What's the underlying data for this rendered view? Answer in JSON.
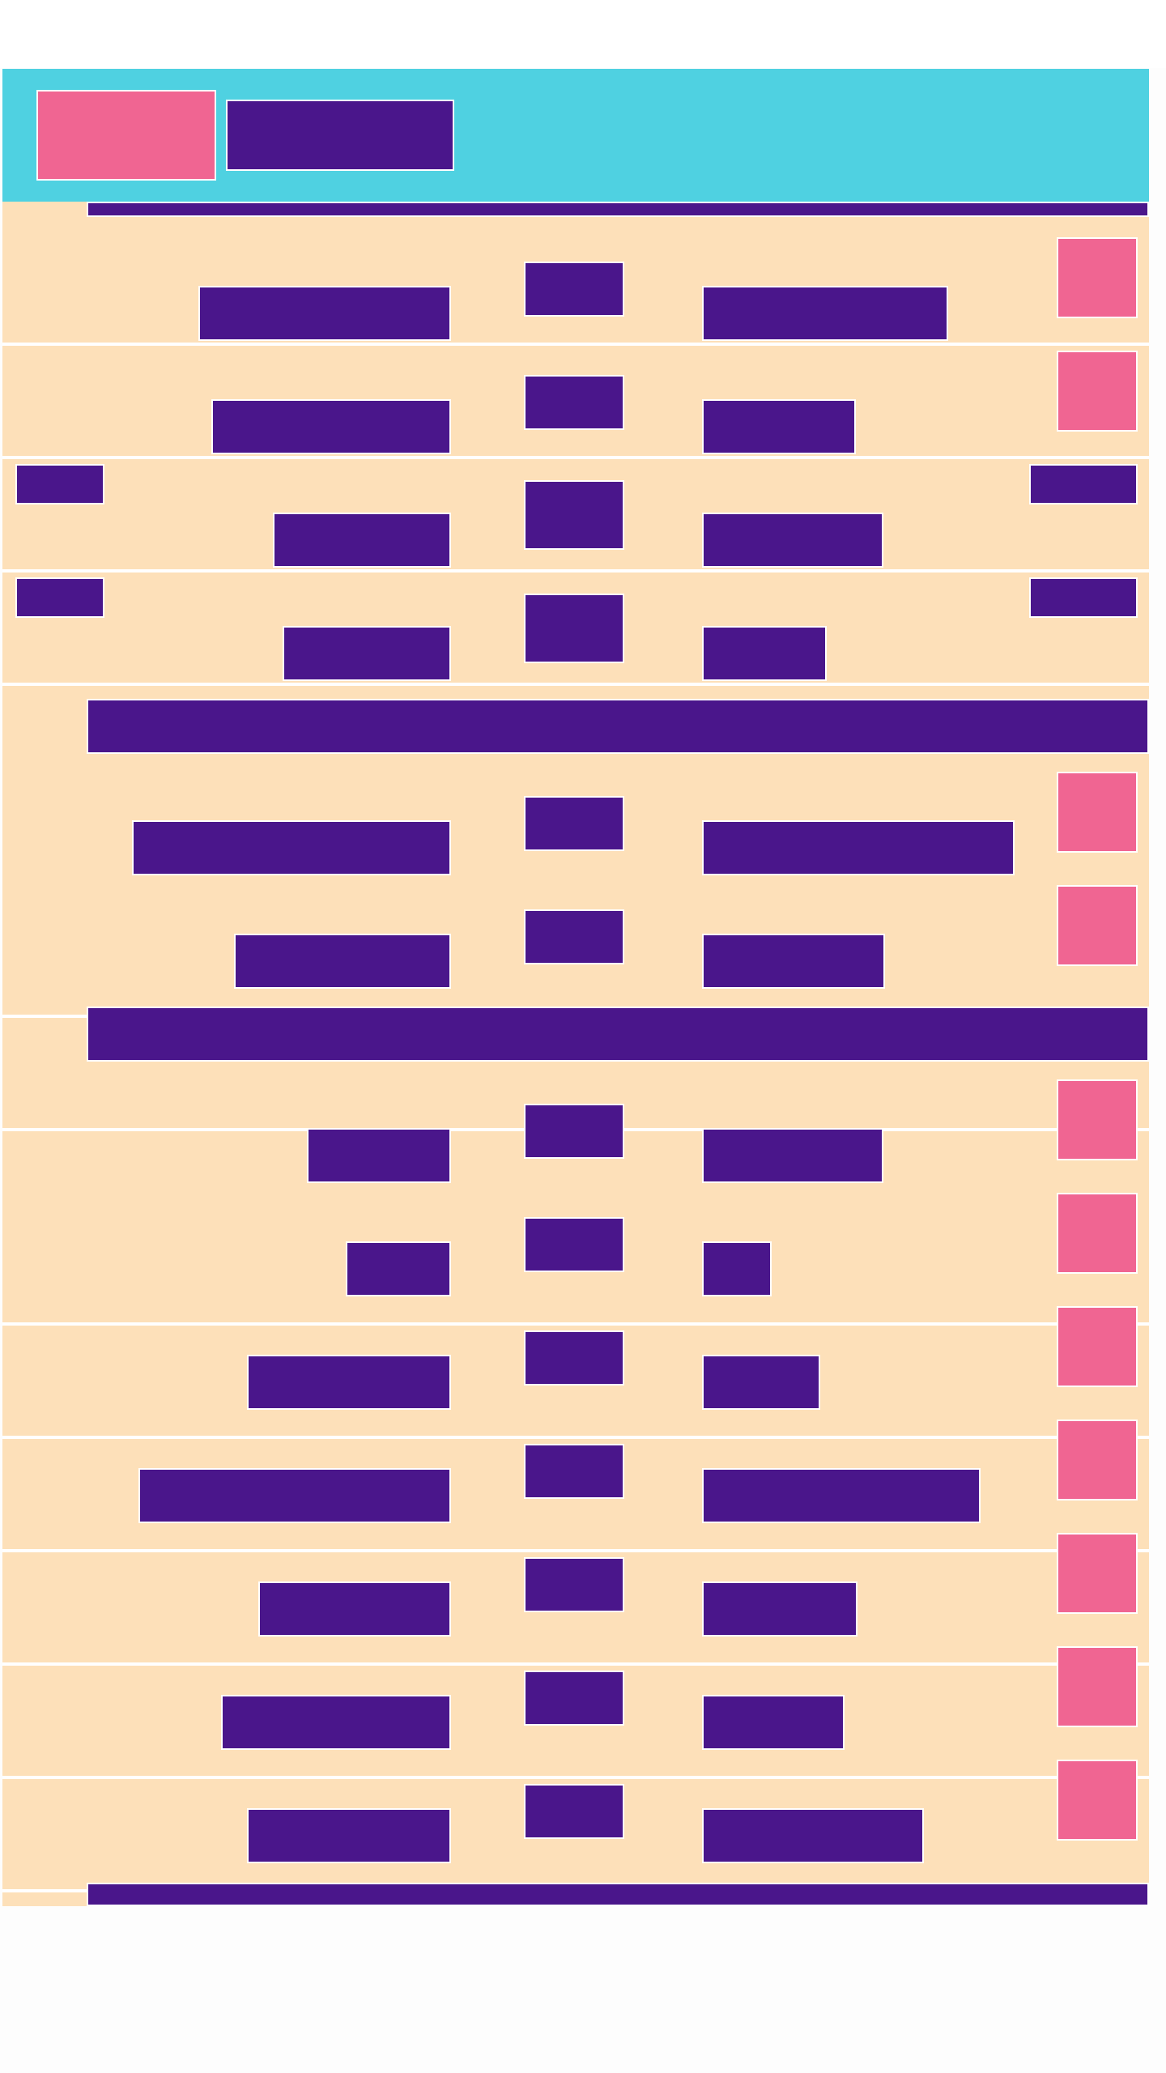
{
  "colors": {
    "header_bg": "#4fd1e1",
    "panel_bg": "#fde0b9",
    "mark": "#4a168b",
    "action": "#f06592",
    "divider": "#ffffff"
  },
  "header": {
    "title": "",
    "action_label": ""
  },
  "rows": [],
  "sections": []
}
